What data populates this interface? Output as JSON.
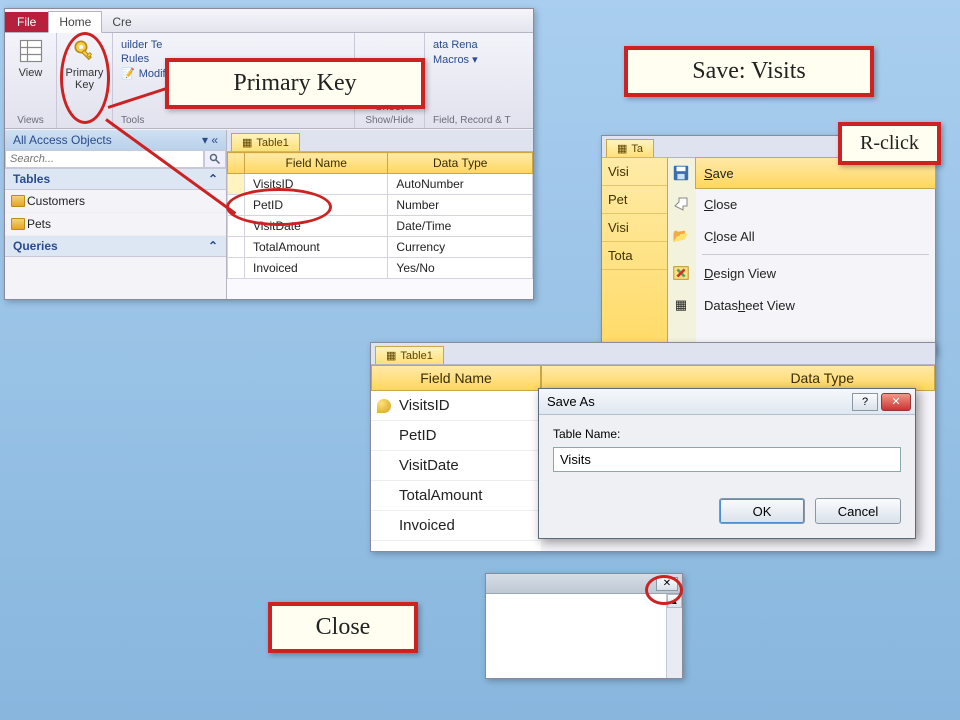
{
  "callouts": {
    "primary_key": "Primary Key",
    "save_visits": "Save: Visits",
    "r_click": "R-click",
    "close": "Close"
  },
  "ribbon": {
    "tabs": {
      "file": "File",
      "home": "Home",
      "create": "Cre"
    },
    "buttons": {
      "view": "View",
      "primary_key": "Primary\nKey",
      "builder": "uilder Te"
    },
    "tools_rows": {
      "rules": "Rules",
      "modify_lookups": "Modify Lookups"
    },
    "groups": {
      "views": "Views",
      "tools": "Tools",
      "showhide": "Show/Hide",
      "fieldrecord": "Field, Record & T"
    },
    "sheet": "Sheet",
    "rename": "ata Rena",
    "macros": "Macros ▾"
  },
  "nav": {
    "header": "All Access Objects",
    "search_placeholder": "Search...",
    "tables_label": "Tables",
    "queries_label": "Queries",
    "items": [
      "Customers",
      "Pets"
    ]
  },
  "design": {
    "tab": "Table1",
    "cols": {
      "field": "Field Name",
      "type": "Data Type"
    },
    "rows": [
      {
        "field": "VisitsID",
        "type": "AutoNumber"
      },
      {
        "field": "PetID",
        "type": "Number"
      },
      {
        "field": "VisitDate",
        "type": "Date/Time"
      },
      {
        "field": "TotalAmount",
        "type": "Currency"
      },
      {
        "field": "Invoiced",
        "type": "Yes/No"
      }
    ]
  },
  "panelB": {
    "tab": "Ta",
    "left_rows": [
      "Visi",
      "Pet",
      "Visi",
      "Tota"
    ],
    "ctx": {
      "save": "Save",
      "close": "Close",
      "close_all": "Close All",
      "design_view": "Design View",
      "datasheet_view": "Datasheet View"
    }
  },
  "panelC": {
    "tab": "Table1",
    "header_field": "Field Name",
    "header_type": "Data Type",
    "rows": [
      "VisitsID",
      "PetID",
      "VisitDate",
      "TotalAmount",
      "Invoiced"
    ]
  },
  "dialog": {
    "title": "Save As",
    "label": "Table Name:",
    "value": "Visits",
    "ok": "OK",
    "cancel": "Cancel"
  }
}
